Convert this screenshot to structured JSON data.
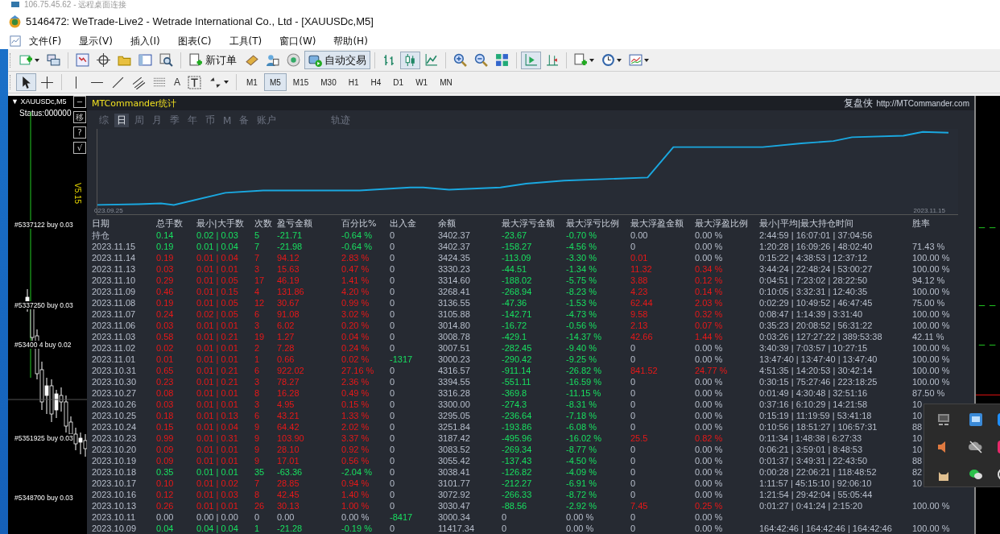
{
  "remote_desktop_title": "106.75.45.62 - 远程桌面连接",
  "window": {
    "title": "5146472: WeTrade-Live2 - Wetrade International Co., Ltd - [XAUUSDc,M5]"
  },
  "menu": [
    "文件(F)",
    "显示(V)",
    "插入(I)",
    "图表(C)",
    "工具(T)",
    "窗口(W)",
    "帮助(H)"
  ],
  "toolbar": {
    "new_order": "新订单",
    "auto_trading": {
      "label": "自动交易",
      "selected": true
    },
    "chart_types": [
      {
        "selected": false
      },
      {
        "selected": true
      },
      {
        "selected": false
      }
    ],
    "auto_scroll": {
      "selected": true
    },
    "chart_shift": {
      "selected": false
    }
  },
  "drawing_toolbar": {
    "tools": [
      {
        "selected": true
      },
      {
        "selected": false
      }
    ],
    "text_tool": "A",
    "timeframes": [
      {
        "label": "M1",
        "selected": false
      },
      {
        "label": "M5",
        "selected": true
      },
      {
        "label": "M15",
        "selected": false
      },
      {
        "label": "M30",
        "selected": false
      },
      {
        "label": "H1",
        "selected": false
      },
      {
        "label": "H4",
        "selected": false
      },
      {
        "label": "D1",
        "selected": false
      },
      {
        "label": "W1",
        "selected": false
      },
      {
        "label": "MN",
        "selected": false
      }
    ]
  },
  "chart_window": {
    "collapse_marker": "▼",
    "title": "XAUUSDc,M5",
    "status": "Status:000000",
    "side_buttons": [
      "−",
      "移",
      "?",
      "√"
    ],
    "version": "V5.15",
    "order_labels": [
      "#5337122 buy 0.03",
      "#5337250 buy 0.03",
      "#53400 4 buy 0.02",
      "#5351925 buy 0.03",
      "#5348700 buy 0.03"
    ]
  },
  "stats_panel": {
    "title": "MTCommander统计",
    "brand": "复盘侠",
    "url": "http://MTCommander.com",
    "tabs": [
      {
        "label": "综",
        "selected": false
      },
      {
        "label": "日",
        "selected": true
      },
      {
        "label": "周",
        "selected": false
      },
      {
        "label": "月",
        "selected": false
      },
      {
        "label": "季",
        "selected": false
      },
      {
        "label": "年",
        "selected": false
      },
      {
        "label": "币",
        "selected": false
      },
      {
        "label": "M",
        "selected": false
      },
      {
        "label": "备",
        "selected": false
      },
      {
        "label": "账户",
        "selected": false
      },
      {
        "label": "轨迹",
        "selected": false
      }
    ],
    "curve_start": "023.09.25",
    "curve_end": "2023.11.15",
    "columns": [
      "日期",
      "总手数",
      "最小|大手数",
      "次数",
      "盈亏金额",
      "百分比%",
      "出入金",
      "余额",
      "最大浮亏金额",
      "最大浮亏比例",
      "最大浮盈金额",
      "最大浮盈比例",
      "最小|平均|最大持仓时间",
      "胜率"
    ],
    "rows": [
      {
        "cells": [
          "持仓",
          "0.14",
          "0.02 | 0.03",
          "5",
          "-21.71",
          "-0.64 %",
          "0",
          "3402.37",
          "-23.67",
          "-0.70 %",
          "0.00",
          "0.00 %",
          "2:44:59 | 16:07:01 | 37:04:56"
        ],
        "kind": "loss",
        "cash_out": false,
        "float_loss_shown": true,
        "float_gain_shown": false,
        "float_gain_pct_shown": false
      },
      {
        "cells": [
          "2023.11.15",
          "0.19",
          "0.01 | 0.04",
          "7",
          "-21.98",
          "-0.64 %",
          "0",
          "3402.37",
          "-158.27",
          "-4.56 %",
          "0",
          "0.00 %",
          "1:20:28 | 16:09:26 | 48:02:40",
          "71.43 %"
        ],
        "kind": "loss",
        "cash_out": false,
        "float_loss_shown": true,
        "float_gain_shown": false,
        "float_gain_pct_shown": false
      },
      {
        "cells": [
          "2023.11.14",
          "0.19",
          "0.01 | 0.04",
          "7",
          "94.12",
          "2.83 %",
          "0",
          "3424.35",
          "-113.09",
          "-3.30 %",
          "0.01",
          "0.00 %",
          "0:15:22 | 4:38:53 | 12:37:12",
          "100.00 %"
        ],
        "kind": "profit",
        "cash_out": false,
        "float_loss_shown": true,
        "float_gain_shown": true,
        "float_gain_pct_shown": false
      },
      {
        "cells": [
          "2023.11.13",
          "0.03",
          "0.01 | 0.01",
          "3",
          "15.63",
          "0.47 %",
          "0",
          "3330.23",
          "-44.51",
          "-1.34 %",
          "11.32",
          "0.34 %",
          "3:44:24 | 22:48:24 | 53:00:27",
          "100.00 %"
        ],
        "kind": "profit",
        "cash_out": false,
        "float_loss_shown": true,
        "float_gain_shown": true,
        "float_gain_pct_shown": true
      },
      {
        "cells": [
          "2023.11.10",
          "0.29",
          "0.01 | 0.05",
          "17",
          "46.19",
          "1.41 %",
          "0",
          "3314.60",
          "-188.02",
          "-5.75 %",
          "3.88",
          "0.12 %",
          "0:04:51 | 7:23:02 | 28:22:50",
          "94.12 %"
        ],
        "kind": "profit",
        "cash_out": false,
        "float_loss_shown": true,
        "float_gain_shown": true,
        "float_gain_pct_shown": true
      },
      {
        "cells": [
          "2023.11.09",
          "0.46",
          "0.01 | 0.15",
          "4",
          "131.86",
          "4.20 %",
          "0",
          "3268.41",
          "-268.94",
          "-8.23 %",
          "4.23",
          "0.14 %",
          "0:10:05 | 3:32:31 | 12:40:35",
          "100.00 %"
        ],
        "kind": "profit",
        "cash_out": false,
        "float_loss_shown": true,
        "float_gain_shown": true,
        "float_gain_pct_shown": true
      },
      {
        "cells": [
          "2023.11.08",
          "0.19",
          "0.01 | 0.05",
          "12",
          "30.67",
          "0.99 %",
          "0",
          "3136.55",
          "-47.36",
          "-1.53 %",
          "62.44",
          "2.03 %",
          "0:02:29 | 10:49:52 | 46:47:45",
          "75.00 %"
        ],
        "kind": "profit",
        "cash_out": false,
        "float_loss_shown": true,
        "float_gain_shown": true,
        "float_gain_pct_shown": true
      },
      {
        "cells": [
          "2023.11.07",
          "0.24",
          "0.02 | 0.05",
          "6",
          "91.08",
          "3.02 %",
          "0",
          "3105.88",
          "-142.71",
          "-4.73 %",
          "9.58",
          "0.32 %",
          "0:08:47 | 1:14:39 | 3:31:40",
          "100.00 %"
        ],
        "kind": "profit",
        "cash_out": false,
        "float_loss_shown": true,
        "float_gain_shown": true,
        "float_gain_pct_shown": true
      },
      {
        "cells": [
          "2023.11.06",
          "0.03",
          "0.01 | 0.01",
          "3",
          "6.02",
          "0.20 %",
          "0",
          "3014.80",
          "-16.72",
          "-0.56 %",
          "2.13",
          "0.07 %",
          "0:35:23 | 20:08:52 | 56:31:22",
          "100.00 %"
        ],
        "kind": "profit",
        "cash_out": false,
        "float_loss_shown": true,
        "float_gain_shown": true,
        "float_gain_pct_shown": true
      },
      {
        "cells": [
          "2023.11.03",
          "0.58",
          "0.01 | 0.21",
          "19",
          "1.27",
          "0.04 %",
          "0",
          "3008.78",
          "-429.1",
          "-14.37 %",
          "42.66",
          "1.44 %",
          "0:03:26 | 127:27:22 | 389:53:38",
          "42.11 %"
        ],
        "kind": "profit",
        "cash_out": false,
        "float_loss_shown": true,
        "float_gain_shown": true,
        "float_gain_pct_shown": true
      },
      {
        "cells": [
          "2023.11.02",
          "0.02",
          "0.01 | 0.01",
          "2",
          "7.28",
          "0.24 %",
          "0",
          "3007.51",
          "-282.45",
          "-9.40 %",
          "0",
          "0.00 %",
          "3:40:39 | 7:03:57 | 10:27:15",
          "100.00 %"
        ],
        "kind": "profit",
        "cash_out": false,
        "float_loss_shown": true,
        "float_gain_shown": false,
        "float_gain_pct_shown": false
      },
      {
        "cells": [
          "2023.11.01",
          "0.01",
          "0.01 | 0.01",
          "1",
          "0.66",
          "0.02 %",
          "-1317",
          "3000.23",
          "-290.42",
          "-9.25 %",
          "0",
          "0.00 %",
          "13:47:40 | 13:47:40 | 13:47:40",
          "100.00 %"
        ],
        "kind": "profit",
        "cash_out": true,
        "float_loss_shown": true,
        "float_gain_shown": false,
        "float_gain_pct_shown": false
      },
      {
        "cells": [
          "2023.10.31",
          "0.65",
          "0.01 | 0.21",
          "6",
          "922.02",
          "27.16 %",
          "0",
          "4316.57",
          "-911.14",
          "-26.82 %",
          "841.52",
          "24.77 %",
          "4:51:35 | 14:20:53 | 30:42:14",
          "100.00 %"
        ],
        "kind": "profit",
        "cash_out": false,
        "float_loss_shown": true,
        "float_gain_shown": true,
        "float_gain_pct_shown": true
      },
      {
        "cells": [
          "2023.10.30",
          "0.23",
          "0.01 | 0.21",
          "3",
          "78.27",
          "2.36 %",
          "0",
          "3394.55",
          "-551.11",
          "-16.59 %",
          "0",
          "0.00 %",
          "0:30:15 | 75:27:46 | 223:18:25",
          "100.00 %"
        ],
        "kind": "profit",
        "cash_out": false,
        "float_loss_shown": true,
        "float_gain_shown": false,
        "float_gain_pct_shown": false
      },
      {
        "cells": [
          "2023.10.27",
          "0.08",
          "0.01 | 0.01",
          "8",
          "16.28",
          "0.49 %",
          "0",
          "3316.28",
          "-369.8",
          "-11.15 %",
          "0",
          "0.00 %",
          "0:01:49 | 4:30:48 | 32:51:16",
          "87.50 %"
        ],
        "kind": "profit",
        "cash_out": false,
        "float_loss_shown": true,
        "float_gain_shown": false,
        "float_gain_pct_shown": false
      },
      {
        "cells": [
          "2023.10.26",
          "0.03",
          "0.01 | 0.01",
          "3",
          "4.95",
          "0.15 %",
          "0",
          "3300.00",
          "-274.3",
          "-8.31 %",
          "0",
          "0.00 %",
          "0:37:16 | 6:10:29 | 14:21:58",
          "10"
        ],
        "kind": "profit",
        "cash_out": false,
        "float_loss_shown": true,
        "float_gain_shown": false,
        "float_gain_pct_shown": false
      },
      {
        "cells": [
          "2023.10.25",
          "0.18",
          "0.01 | 0.13",
          "6",
          "43.21",
          "1.33 %",
          "0",
          "3295.05",
          "-236.64",
          "-7.18 %",
          "0",
          "0.00 %",
          "0:15:19 | 11:19:59 | 53:41:18",
          "10"
        ],
        "kind": "profit",
        "cash_out": false,
        "float_loss_shown": true,
        "float_gain_shown": false,
        "float_gain_pct_shown": false
      },
      {
        "cells": [
          "2023.10.24",
          "0.15",
          "0.01 | 0.04",
          "9",
          "64.42",
          "2.02 %",
          "0",
          "3251.84",
          "-193.86",
          "-6.08 %",
          "0",
          "0.00 %",
          "0:10:56 | 18:51:27 | 106:57:31",
          "88"
        ],
        "kind": "profit",
        "cash_out": false,
        "float_loss_shown": true,
        "float_gain_shown": false,
        "float_gain_pct_shown": false
      },
      {
        "cells": [
          "2023.10.23",
          "0.99",
          "0.01 | 0.31",
          "9",
          "103.90",
          "3.37 %",
          "0",
          "3187.42",
          "-495.96",
          "-16.02 %",
          "25.5",
          "0.82 %",
          "0:11:34 | 1:48:38 | 6:27:33",
          "10"
        ],
        "kind": "profit",
        "cash_out": false,
        "float_loss_shown": true,
        "float_gain_shown": true,
        "float_gain_pct_shown": true
      },
      {
        "cells": [
          "2023.10.20",
          "0.09",
          "0.01 | 0.01",
          "9",
          "28.10",
          "0.92 %",
          "0",
          "3083.52",
          "-269.34",
          "-8.77 %",
          "0",
          "0.00 %",
          "0:06:21 | 3:59:01 | 8:48:53",
          "10"
        ],
        "kind": "profit",
        "cash_out": false,
        "float_loss_shown": true,
        "float_gain_shown": false,
        "float_gain_pct_shown": false
      },
      {
        "cells": [
          "2023.10.19",
          "0.09",
          "0.01 | 0.01",
          "9",
          "17.01",
          "0.56 %",
          "0",
          "3055.42",
          "-137.43",
          "-4.50 %",
          "0",
          "0.00 %",
          "0:01:37 | 3:49:31 | 22:43:50",
          "88"
        ],
        "kind": "profit",
        "cash_out": false,
        "float_loss_shown": true,
        "float_gain_shown": false,
        "float_gain_pct_shown": false
      },
      {
        "cells": [
          "2023.10.18",
          "0.35",
          "0.01 | 0.01",
          "35",
          "-63.36",
          "-2.04 %",
          "0",
          "3038.41",
          "-126.82",
          "-4.09 %",
          "0",
          "0.00 %",
          "0:00:28 | 22:06:21 | 118:48:52",
          "82"
        ],
        "kind": "loss",
        "cash_out": false,
        "float_loss_shown": true,
        "float_gain_shown": false,
        "float_gain_pct_shown": false
      },
      {
        "cells": [
          "2023.10.17",
          "0.10",
          "0.01 | 0.02",
          "7",
          "28.85",
          "0.94 %",
          "0",
          "3101.77",
          "-212.27",
          "-6.91 %",
          "0",
          "0.00 %",
          "1:11:57 | 45:15:10 | 92:06:10",
          "10"
        ],
        "kind": "profit",
        "cash_out": false,
        "float_loss_shown": true,
        "float_gain_shown": false,
        "float_gain_pct_shown": false
      },
      {
        "cells": [
          "2023.10.16",
          "0.12",
          "0.01 | 0.03",
          "8",
          "42.45",
          "1.40 %",
          "0",
          "3072.92",
          "-266.33",
          "-8.72 %",
          "0",
          "0.00 %",
          "1:21:54 | 29:42:04 | 55:05:44"
        ],
        "kind": "profit",
        "cash_out": false,
        "float_loss_shown": true,
        "float_gain_shown": false,
        "float_gain_pct_shown": false
      },
      {
        "cells": [
          "2023.10.13",
          "0.26",
          "0.01 | 0.01",
          "26",
          "30.13",
          "1.00 %",
          "0",
          "3030.47",
          "-88.56",
          "-2.92 %",
          "7.45",
          "0.25 %",
          "0:01:27 | 0:41:24 | 2:15:20",
          "100.00 %"
        ],
        "kind": "profit",
        "cash_out": false,
        "float_loss_shown": true,
        "float_gain_shown": true,
        "float_gain_pct_shown": true
      },
      {
        "cells": [
          "2023.10.11",
          "0.00",
          "0.00 | 0.00",
          "0",
          "0.00",
          "0.00 %",
          "-8417",
          "3000.34",
          "0",
          "0.00 %",
          "0",
          "0.00 %"
        ],
        "kind": "flat",
        "cash_out": true,
        "float_loss_shown": false,
        "float_gain_shown": false,
        "float_gain_pct_shown": false
      },
      {
        "cells": [
          "2023.10.09",
          "0.04",
          "0.04 | 0.04",
          "1",
          "-21.28",
          "-0.19 %",
          "0",
          "11417.34",
          "0",
          "0.00 %",
          "0",
          "0.00 %",
          "164:42:46 | 164:42:46 | 164:42:46",
          "100.00 %"
        ],
        "kind": "loss",
        "cash_out": false,
        "float_loss_shown": false,
        "float_gain_shown": false,
        "float_gain_pct_shown": false
      }
    ]
  }
}
